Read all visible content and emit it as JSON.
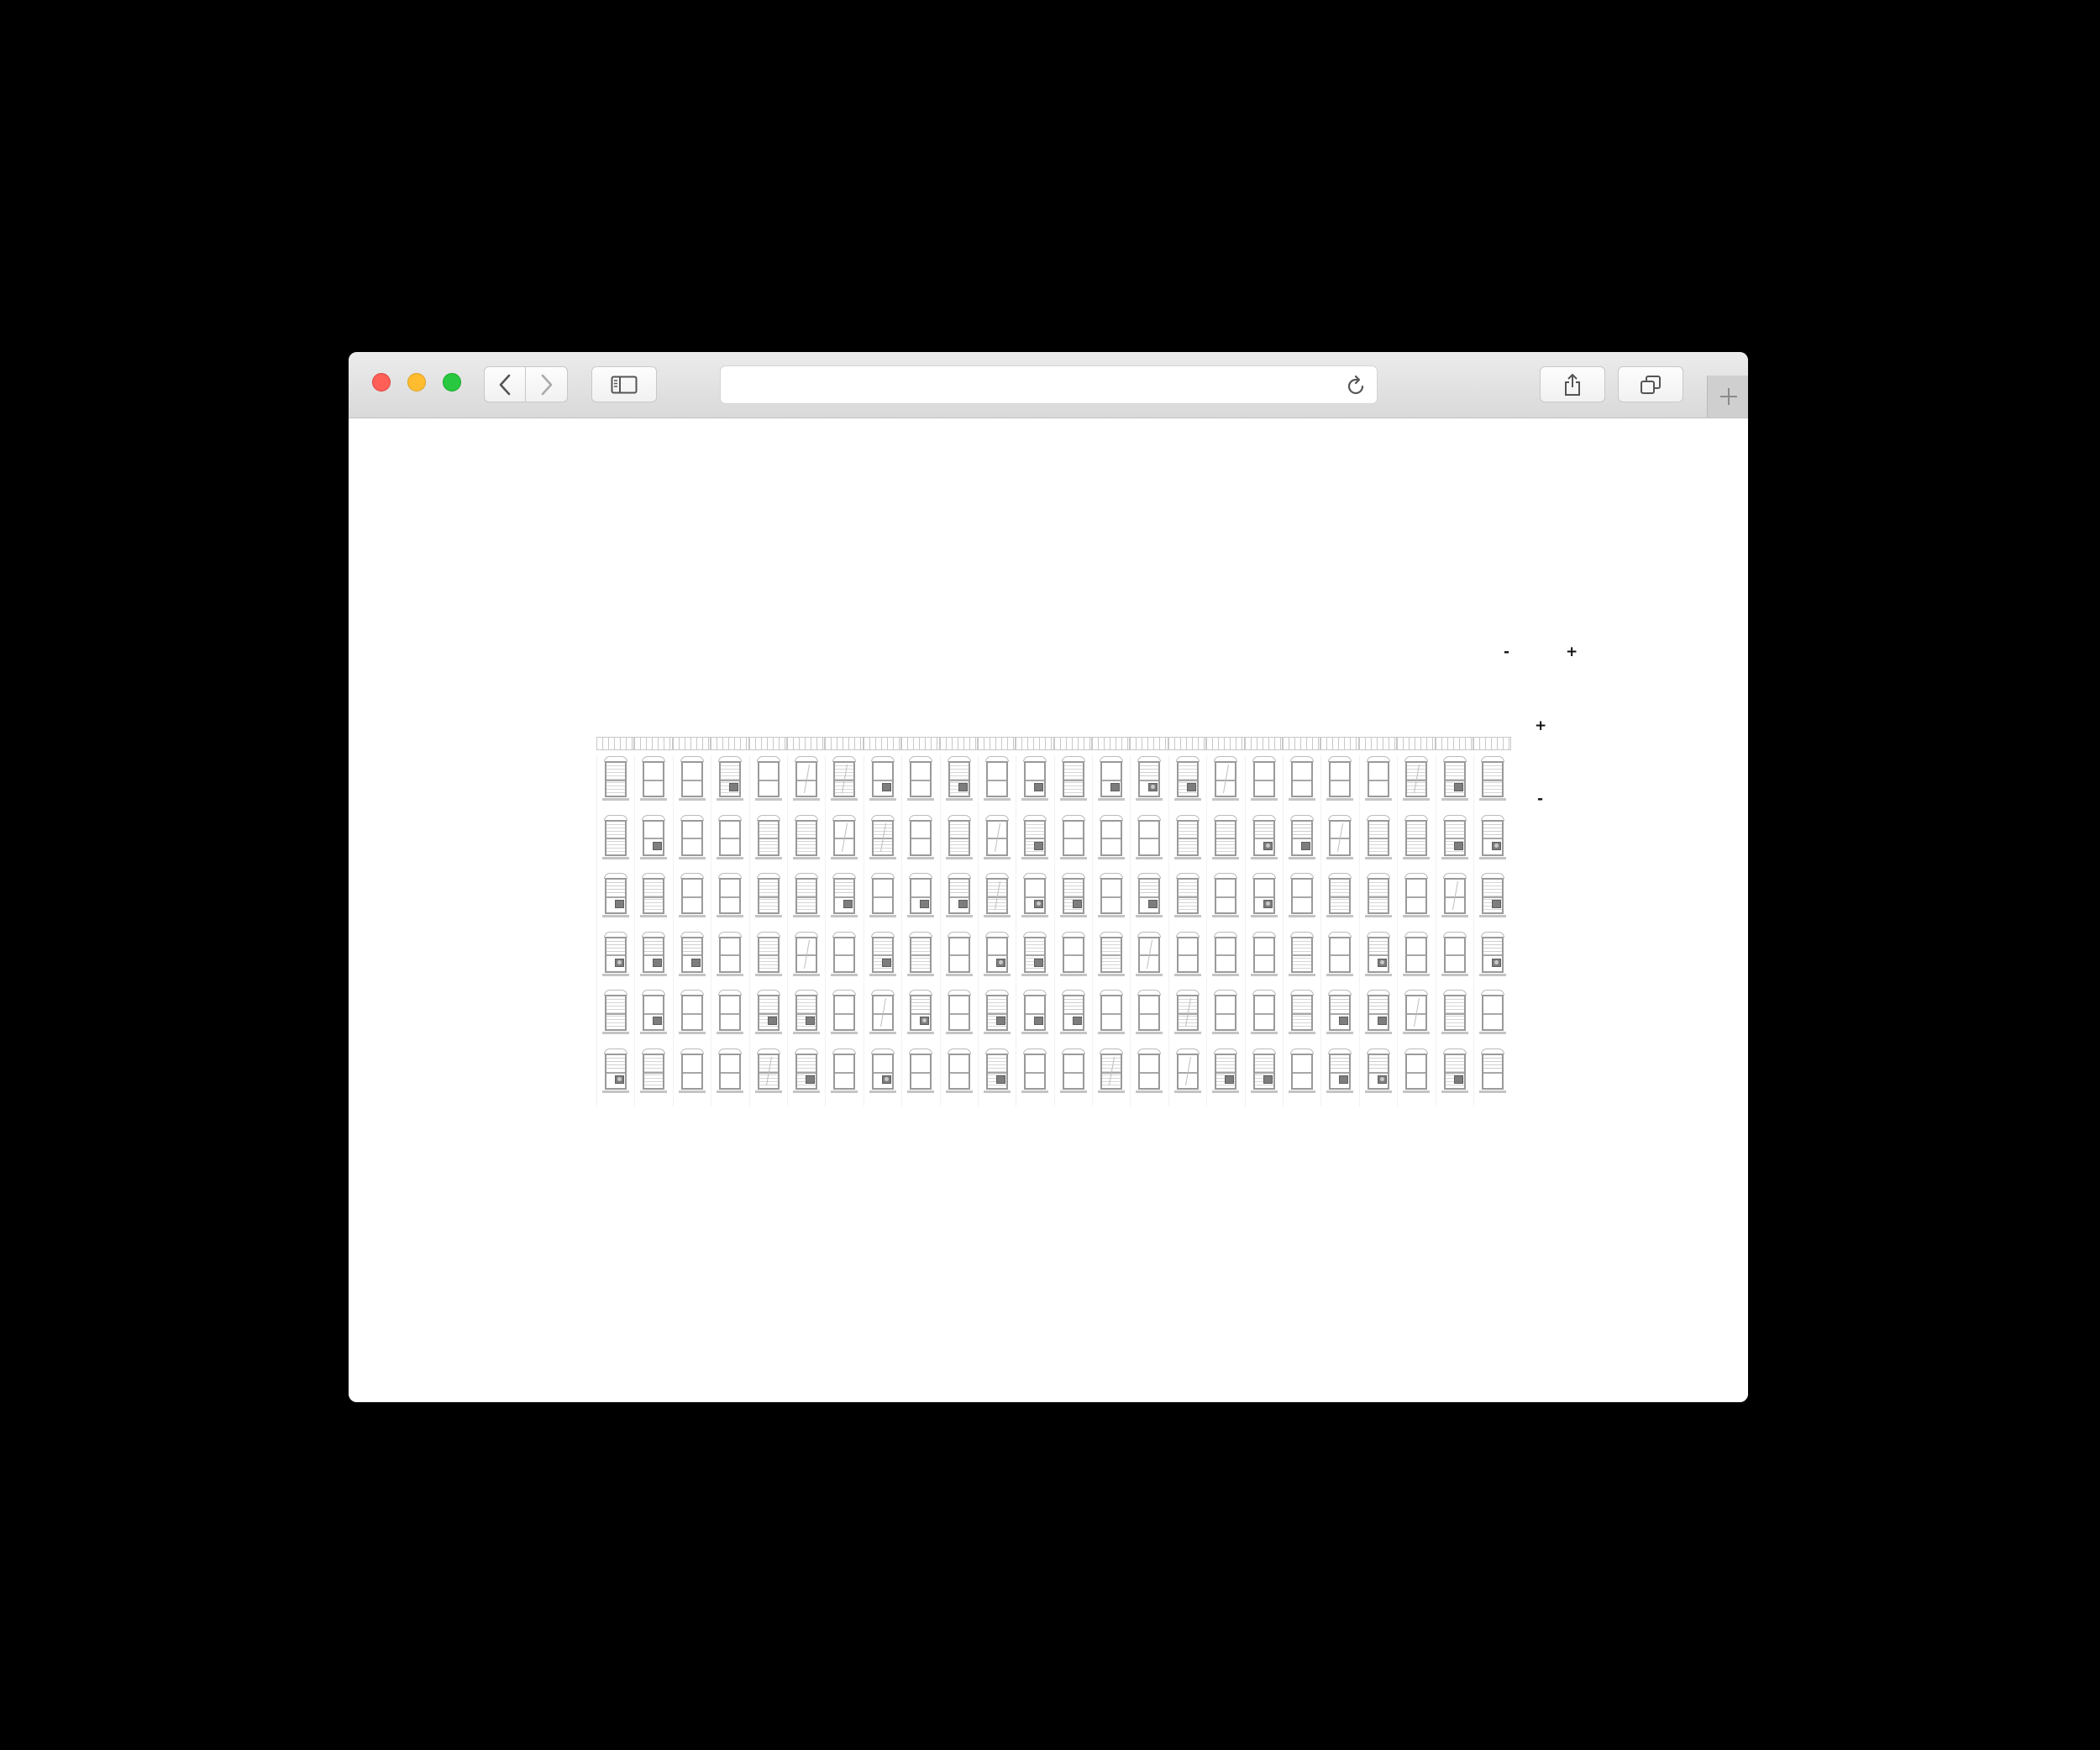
{
  "browser": {
    "address_value": "",
    "icons": {
      "back": "chevron-left-icon",
      "forward": "chevron-right-icon",
      "sidebar": "sidebar-icon",
      "reload": "reload-icon",
      "share": "share-icon",
      "tabs": "tabs-icon",
      "new_tab": "plus-icon"
    }
  },
  "controls": {
    "zoom_out_label": "-",
    "zoom_in_label": "+",
    "add_floor_label": "+",
    "remove_floor_label": "-"
  },
  "building": {
    "columns": 24,
    "floors": [
      [
        "blind",
        "plain",
        "plain",
        "blind-ac",
        "plain",
        "plain-curtain",
        "blind-curtain",
        "plain-ac",
        "plain",
        "blind-ac",
        "plain",
        "plain-ac",
        "blind",
        "plain-ac",
        "half-fan",
        "blind-ac",
        "plain-curtain",
        "plain",
        "plain",
        "plain",
        "plain",
        "blind-curtain",
        "blind-ac",
        "blind"
      ],
      [
        "blind",
        "plain-ac",
        "plain",
        "plain",
        "blind",
        "blind",
        "plain-curtain",
        "blind-curtain",
        "plain",
        "blind",
        "plain-curtain",
        "blind-ac",
        "plain",
        "plain",
        "plain",
        "blind",
        "blind",
        "half-fan",
        "half-ac",
        "plain-curtain",
        "blind",
        "blind",
        "blind-ac",
        "half-fan"
      ],
      [
        "half-ac",
        "blind",
        "plain",
        "plain",
        "blind",
        "blind",
        "half-ac",
        "plain",
        "plain-ac",
        "half-ac",
        "blind-curtain",
        "plain-fan",
        "blind-ac",
        "plain",
        "half-ac",
        "blind",
        "plain",
        "plain-fan",
        "plain",
        "blind",
        "blind",
        "plain",
        "plain-curtain",
        "blind-ac"
      ],
      [
        "half-fan",
        "half-ac",
        "half-ac",
        "plain",
        "blind",
        "plain-curtain",
        "plain",
        "blind-ac",
        "blind",
        "plain",
        "plain-fan",
        "blind-ac",
        "plain",
        "blind",
        "plain-curtain",
        "plain",
        "plain",
        "plain",
        "blind",
        "plain",
        "half-fan",
        "plain",
        "plain",
        "half-fan"
      ],
      [
        "blind",
        "plain-ac",
        "plain",
        "plain",
        "blind-ac",
        "blind-ac",
        "plain",
        "plain-curtain",
        "half-fan",
        "plain",
        "blind-ac",
        "plain-ac",
        "half-ac",
        "plain",
        "plain",
        "blind-curtain",
        "plain",
        "plain",
        "blind",
        "half-ac",
        "half-ac",
        "plain-curtain",
        "blind"
      ],
      [
        "half-fan",
        "blind",
        "plain",
        "plain",
        "blind-curtain",
        "blind-ac",
        "plain",
        "plain-fan",
        "plain",
        "plain",
        "blind-ac",
        "plain",
        "plain",
        "blind-curtain",
        "plain",
        "plain-curtain",
        "blind-ac",
        "blind-ac",
        "plain",
        "half-ac",
        "half-fan",
        "plain",
        "blind-ac",
        "half"
      ]
    ]
  }
}
